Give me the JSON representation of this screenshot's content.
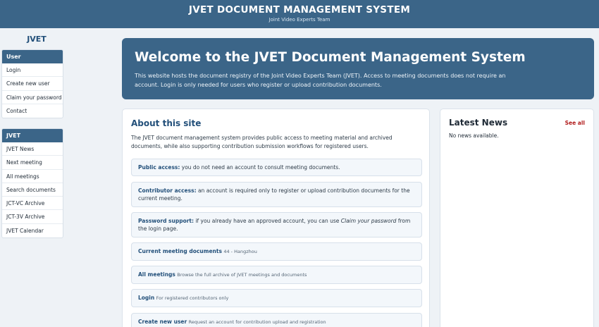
{
  "header": {
    "title": "JVET DOCUMENT MANAGEMENT SYSTEM",
    "subtitle": "Joint Video Experts Team"
  },
  "sidebar": {
    "title": "JVET",
    "user_section": {
      "heading": "User",
      "items": [
        "Login",
        "Create new user",
        "Claim your password",
        "Contact"
      ]
    },
    "jvet_section": {
      "heading": "JVET",
      "items": [
        "JVET News",
        "Next meeting",
        "All meetings",
        "Search documents",
        "JCT-VC Archive",
        "JCT-3V Archive",
        "JVET Calendar"
      ]
    }
  },
  "hero": {
    "title": "Welcome to the JVET Document Management System",
    "text": "This website hosts the document registry of the Joint Video Experts Team (JVET). Access to meeting documents does not require an account. Login is only needed for users who register or upload contribution documents."
  },
  "about": {
    "title": "About this site",
    "intro": "The JVET document management system provides public access to meeting material and archived documents, while also supporting contribution submission workflows for registered users.",
    "features": [
      {
        "label": "Public access:",
        "text": " you do not need an account to consult meeting documents."
      },
      {
        "label": "Contributor access:",
        "text": " an account is required only to register or upload contribution documents for the current meeting."
      },
      {
        "label": "Password support:",
        "text_before": " if you already have an approved account, you can use ",
        "emphasis": "Claim your password",
        "text_after": " from the login page."
      }
    ],
    "links": [
      {
        "label": "Current meeting documents",
        "desc": "44 - Hangzhou"
      },
      {
        "label": "All meetings",
        "desc": "Browse the full archive of JVET meetings and documents"
      },
      {
        "label": "Login",
        "desc": "For registered contributors only"
      },
      {
        "label": "Create new user",
        "desc": "Request an account for contribution upload and registration"
      }
    ]
  },
  "news": {
    "title": "Latest News",
    "see_all": "See all",
    "empty": "No news available."
  },
  "colors": {
    "brand": "#3b6588",
    "accent_red": "#b21e1e",
    "heading": "#23507a"
  }
}
